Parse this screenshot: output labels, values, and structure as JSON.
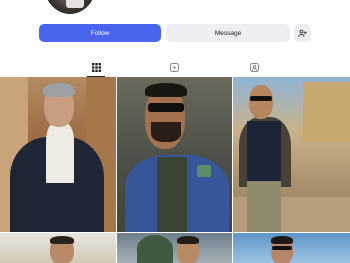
{
  "profile": {
    "follow_label": "Follow",
    "message_label": "Message",
    "add_friend_icon": "person-plus-icon"
  },
  "tabs": [
    {
      "name": "posts",
      "icon": "grid-icon",
      "active": true
    },
    {
      "name": "reels",
      "icon": "reels-icon",
      "active": false
    },
    {
      "name": "tagged",
      "icon": "tagged-icon",
      "active": false
    }
  ],
  "colors": {
    "follow_button": "#4a66ee",
    "secondary_button": "#eceef2",
    "background": "#ffffff"
  }
}
